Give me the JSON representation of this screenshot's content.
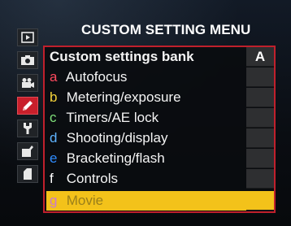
{
  "menu": {
    "title": "CUSTOM SETTING MENU",
    "bank_label": "Custom settings bank",
    "bank_value": "A",
    "items": [
      {
        "letter": "a",
        "label": "Autofocus",
        "letter_color": "#ff4a5e"
      },
      {
        "letter": "b",
        "label": "Metering/exposure",
        "letter_color": "#f4d33a"
      },
      {
        "letter": "c",
        "label": "Timers/AE lock",
        "letter_color": "#7fe07a"
      },
      {
        "letter": "d",
        "label": "Shooting/display",
        "letter_color": "#5fb3ff"
      },
      {
        "letter": "e",
        "label": "Bracketing/flash",
        "letter_color": "#2f8cff"
      },
      {
        "letter": "f",
        "label": "Controls",
        "letter_color": "#ffffff"
      },
      {
        "letter": "g",
        "label": "Movie",
        "letter_color": "#c97bd0"
      }
    ],
    "selected_item": "g"
  },
  "sidebar": {
    "tabs": [
      {
        "icon": "playback-icon"
      },
      {
        "icon": "camera-icon"
      },
      {
        "icon": "movie-camera-icon"
      },
      {
        "icon": "pencil-icon",
        "active": true
      },
      {
        "icon": "wrench-icon"
      },
      {
        "icon": "retouch-icon"
      },
      {
        "icon": "my-menu-icon"
      }
    ]
  },
  "colors": {
    "accent": "#c81f2b",
    "highlight": "#f3c21a",
    "background": "#0a0d12"
  }
}
